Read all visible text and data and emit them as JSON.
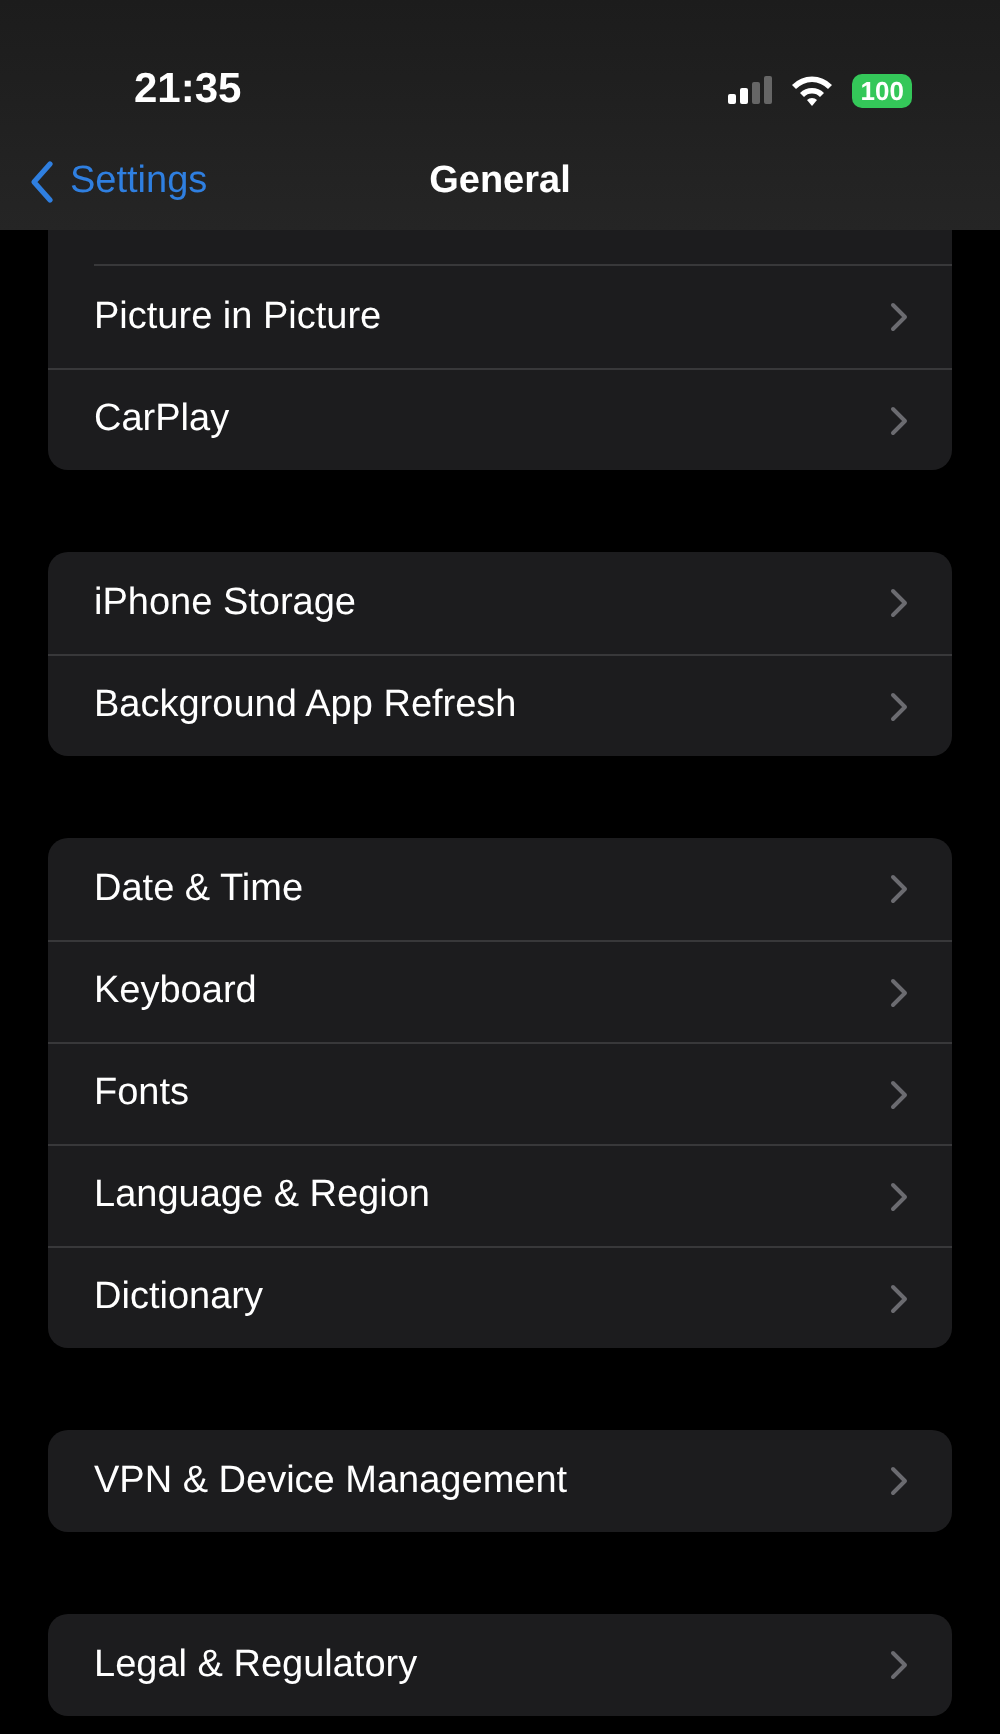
{
  "status_bar": {
    "time": "21:35",
    "battery": "100"
  },
  "nav": {
    "back": "Settings",
    "title": "General"
  },
  "groups": [
    {
      "cut_top": true,
      "items": [
        {
          "label": "Picture in Picture"
        },
        {
          "label": "CarPlay"
        }
      ]
    },
    {
      "cut_top": false,
      "items": [
        {
          "label": "iPhone Storage"
        },
        {
          "label": "Background App Refresh"
        }
      ]
    },
    {
      "cut_top": false,
      "items": [
        {
          "label": "Date & Time"
        },
        {
          "label": "Keyboard"
        },
        {
          "label": "Fonts"
        },
        {
          "label": "Language & Region"
        },
        {
          "label": "Dictionary"
        }
      ]
    },
    {
      "cut_top": false,
      "items": [
        {
          "label": "VPN & Device Management"
        }
      ]
    },
    {
      "cut_top": false,
      "items": [
        {
          "label": "Legal & Regulatory"
        }
      ]
    }
  ]
}
